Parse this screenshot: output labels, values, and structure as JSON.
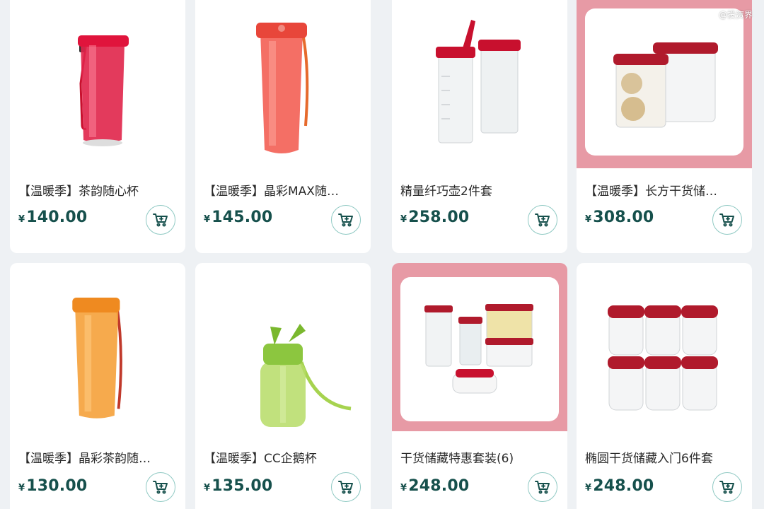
{
  "watermark": "@投资界",
  "products": [
    {
      "title": "【温暖季】茶韵随心杯",
      "currency": "¥",
      "price": "140.00",
      "image": "red-tumbler-with-strap"
    },
    {
      "title": "【温暖季】晶彩MAX随…",
      "currency": "¥",
      "price": "145.00",
      "image": "coral-tumbler-with-strap"
    },
    {
      "title": "精量纤巧壶2件套",
      "currency": "¥",
      "price": "258.00",
      "image": "two-pitchers-red-lids"
    },
    {
      "title": "【温暖季】长方干货储…",
      "currency": "¥",
      "price": "308.00",
      "image": "rectangular-storage-containers",
      "promo_frame": true
    },
    {
      "title": "【温暖季】晶彩茶韵随…",
      "currency": "¥",
      "price": "130.00",
      "image": "orange-tumbler-with-strap"
    },
    {
      "title": "【温暖季】CC企鹅杯",
      "currency": "¥",
      "price": "135.00",
      "image": "green-kids-bottle"
    },
    {
      "title": "干货储藏特惠套装(6)",
      "currency": "¥",
      "price": "248.00",
      "image": "storage-set-six-pieces",
      "promo_frame": true
    },
    {
      "title": "椭圆干货储藏入门6件套",
      "currency": "¥",
      "price": "248.00",
      "image": "oval-storage-six-stack"
    }
  ],
  "colors": {
    "price": "#16504c",
    "cart_border": "#8fc9c3",
    "promo_frame": "#e79aa5",
    "background": "#eef1f4"
  },
  "icons": {
    "cart": "cart-icon"
  }
}
